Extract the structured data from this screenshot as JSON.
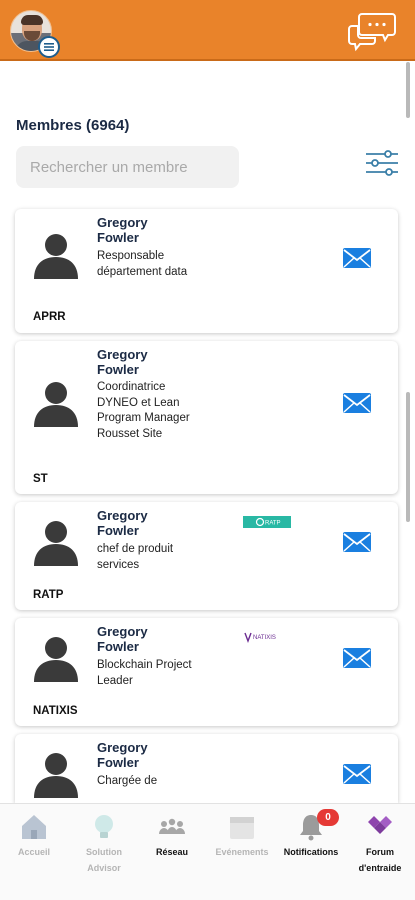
{
  "header": {
    "colors": {
      "background": "#e9832a"
    },
    "icons": {
      "avatar": "user-avatar-photo",
      "menu": "menu-icon",
      "chat": "chat-bubbles-icon"
    }
  },
  "members": {
    "title": "Membres (6964)",
    "search_placeholder": "Rechercher un membre",
    "filter_icon": "sliders-icon",
    "cards": [
      {
        "name": "Gregory Fowler",
        "role": "Responsable département data",
        "company": "APRR",
        "logo": ""
      },
      {
        "name": "Gregory Fowler",
        "role": "Coordinatrice DYNEO et Lean Program Manager Rousset Site",
        "company": "ST",
        "logo": ""
      },
      {
        "name": "Gregory Fowler",
        "role": "chef de produit services",
        "company": "RATP",
        "logo": "RATP"
      },
      {
        "name": "Gregory Fowler",
        "role": "Blockchain Project Leader",
        "company": "NATIXIS",
        "logo": "NATIXIS"
      },
      {
        "name": "Gregory Fowler",
        "role": "Chargée de",
        "company": "",
        "logo": ""
      }
    ]
  },
  "bottom_nav": {
    "items": [
      {
        "label": "Accueil",
        "icon": "home-icon",
        "active": false
      },
      {
        "label": "Solution Advisor",
        "icon": "lightbulb-icon",
        "active": false
      },
      {
        "label": "Réseau",
        "icon": "network-people-icon",
        "active": true
      },
      {
        "label": "Evénements",
        "icon": "calendar-icon",
        "active": false
      },
      {
        "label": "Notifications",
        "icon": "bell-icon",
        "active": true,
        "badge": "0"
      },
      {
        "label": "Forum d'entraide",
        "icon": "forum-diamond-icon",
        "active": true
      }
    ]
  }
}
